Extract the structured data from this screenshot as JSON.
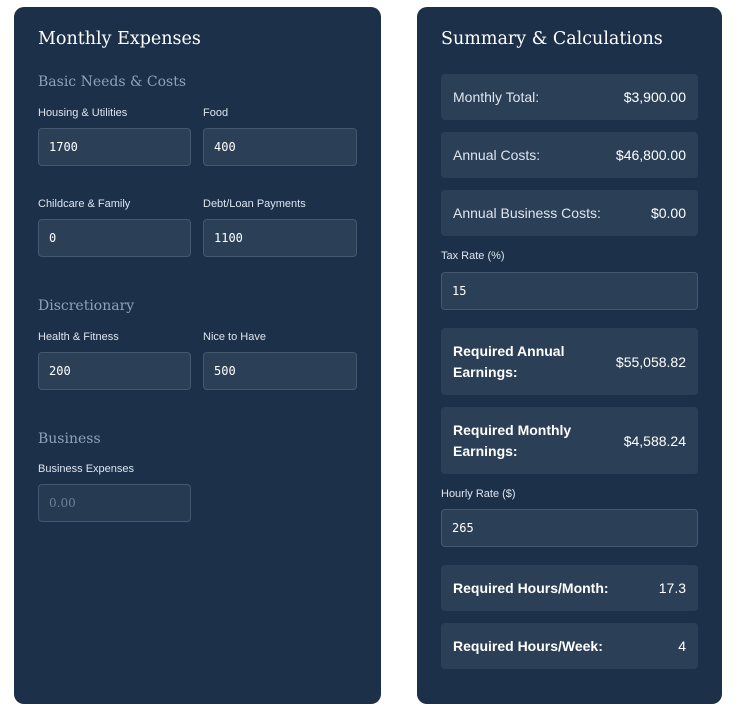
{
  "expenses": {
    "title": "Monthly Expenses",
    "basic_section": "Basic Needs & Costs",
    "housing": {
      "label": "Housing & Utilities",
      "value": "1700"
    },
    "food": {
      "label": "Food",
      "value": "400"
    },
    "childcare": {
      "label": "Childcare & Family",
      "value": "0"
    },
    "debt": {
      "label": "Debt/Loan Payments",
      "value": "1100"
    },
    "discretionary_section": "Discretionary",
    "health": {
      "label": "Health & Fitness",
      "value": "200"
    },
    "nice": {
      "label": "Nice to Have",
      "value": "500"
    },
    "business_section": "Business",
    "business": {
      "label": "Business Expenses",
      "value": "",
      "placeholder": "0.00"
    }
  },
  "summary": {
    "title": "Summary & Calculations",
    "monthly_total": {
      "label": "Monthly Total:",
      "value": "$3,900.00"
    },
    "annual_costs": {
      "label": "Annual Costs:",
      "value": "$46,800.00"
    },
    "annual_business": {
      "label": "Annual Business Costs:",
      "value": "$0.00"
    },
    "tax_rate": {
      "label": "Tax Rate (%)",
      "value": "15"
    },
    "req_annual": {
      "label": "Required Annual Earnings:",
      "value": "$55,058.82"
    },
    "req_monthly": {
      "label": "Required Monthly Earnings:",
      "value": "$4,588.24"
    },
    "hourly_rate": {
      "label": "Hourly Rate ($)",
      "value": "265"
    },
    "hours_month": {
      "label": "Required Hours/Month:",
      "value": "17.3"
    },
    "hours_week": {
      "label": "Required Hours/Week:",
      "value": "4"
    }
  }
}
